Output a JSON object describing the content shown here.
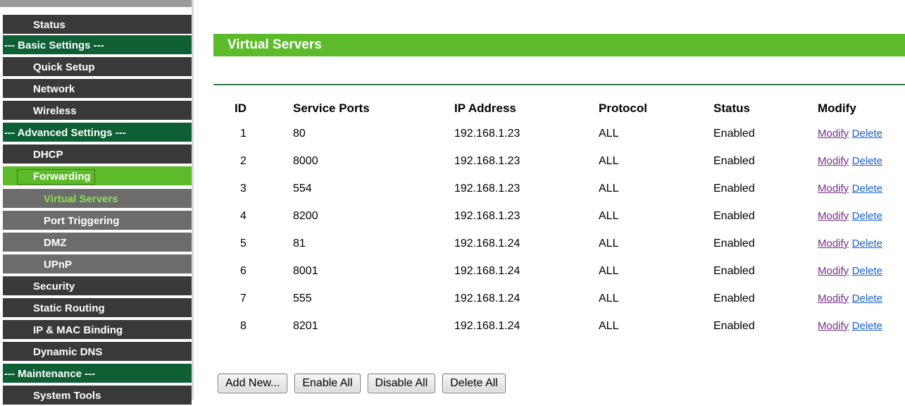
{
  "sidebar": {
    "items": [
      {
        "label": "Status",
        "kind": "dark"
      },
      {
        "label": "--- Basic Settings ---",
        "kind": "section"
      },
      {
        "label": "Quick Setup",
        "kind": "dark"
      },
      {
        "label": "Network",
        "kind": "dark"
      },
      {
        "label": "Wireless",
        "kind": "dark"
      },
      {
        "label": "--- Advanced Settings ---",
        "kind": "section"
      },
      {
        "label": "DHCP",
        "kind": "dark"
      },
      {
        "label": "Forwarding",
        "kind": "active"
      },
      {
        "label": "Virtual Servers",
        "kind": "sub-current"
      },
      {
        "label": "Port Triggering",
        "kind": "sub"
      },
      {
        "label": "DMZ",
        "kind": "sub"
      },
      {
        "label": "UPnP",
        "kind": "sub"
      },
      {
        "label": "Security",
        "kind": "dark"
      },
      {
        "label": "Static Routing",
        "kind": "dark"
      },
      {
        "label": "IP & MAC Binding",
        "kind": "dark"
      },
      {
        "label": "Dynamic DNS",
        "kind": "dark"
      },
      {
        "label": "--- Maintenance ---",
        "kind": "section"
      },
      {
        "label": "System Tools",
        "kind": "dark"
      }
    ]
  },
  "main": {
    "title": "Virtual Servers",
    "table": {
      "headers": [
        "ID",
        "Service Ports",
        "IP Address",
        "Protocol",
        "Status",
        "Modify"
      ],
      "rows": [
        {
          "id": "1",
          "port": "80",
          "ip": "192.168.1.23",
          "protocol": "ALL",
          "status": "Enabled"
        },
        {
          "id": "2",
          "port": "8000",
          "ip": "192.168.1.23",
          "protocol": "ALL",
          "status": "Enabled"
        },
        {
          "id": "3",
          "port": "554",
          "ip": "192.168.1.23",
          "protocol": "ALL",
          "status": "Enabled"
        },
        {
          "id": "4",
          "port": "8200",
          "ip": "192.168.1.23",
          "protocol": "ALL",
          "status": "Enabled"
        },
        {
          "id": "5",
          "port": "81",
          "ip": "192.168.1.24",
          "protocol": "ALL",
          "status": "Enabled"
        },
        {
          "id": "6",
          "port": "8001",
          "ip": "192.168.1.24",
          "protocol": "ALL",
          "status": "Enabled"
        },
        {
          "id": "7",
          "port": "555",
          "ip": "192.168.1.24",
          "protocol": "ALL",
          "status": "Enabled"
        },
        {
          "id": "8",
          "port": "8201",
          "ip": "192.168.1.24",
          "protocol": "ALL",
          "status": "Enabled"
        }
      ],
      "modify_link": "Modify",
      "delete_link": "Delete"
    },
    "buttons": {
      "add_new": "Add New...",
      "enable_all": "Enable All",
      "disable_all": "Disable All",
      "delete_all": "Delete All"
    }
  },
  "colors": {
    "accent_green": "#5dbb2b",
    "section_green": "#0e5f33",
    "menu_dark": "#393939",
    "submenu_gray": "#6c6c6c",
    "link_modify": "#7a2b8a",
    "link_delete": "#1a5fd0"
  }
}
